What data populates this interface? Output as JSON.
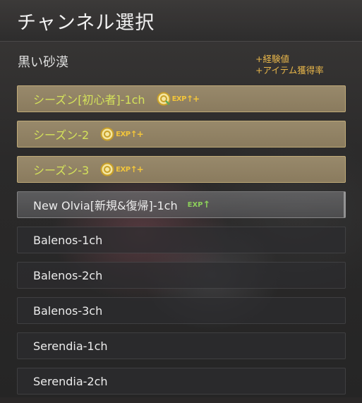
{
  "window": {
    "title": "チャンネル選択"
  },
  "server": {
    "name": "黒い砂漠"
  },
  "legend": {
    "line1": "+経験値",
    "line2": "+アイテム獲得率"
  },
  "channels": [
    {
      "label": "シーズン[初心者]-1ch",
      "type": "premium"
    },
    {
      "label": "シーズン-2",
      "type": "premium"
    },
    {
      "label": "シーズン-3",
      "type": "premium"
    },
    {
      "label": "New Olvia[新規&復帰]-1ch",
      "type": "new"
    },
    {
      "label": "Balenos-1ch",
      "type": "normal"
    },
    {
      "label": "Balenos-2ch",
      "type": "normal"
    },
    {
      "label": "Balenos-3ch",
      "type": "normal"
    },
    {
      "label": "Serendia-1ch",
      "type": "normal"
    },
    {
      "label": "Serendia-2ch",
      "type": "normal"
    }
  ],
  "badges": {
    "exp": "EXP",
    "plus": "+",
    "arrow": "↑"
  },
  "colors": {
    "accent": "#e8b64a",
    "premium_text": "#d4e25a",
    "exp_green": "#8ccf5a"
  }
}
